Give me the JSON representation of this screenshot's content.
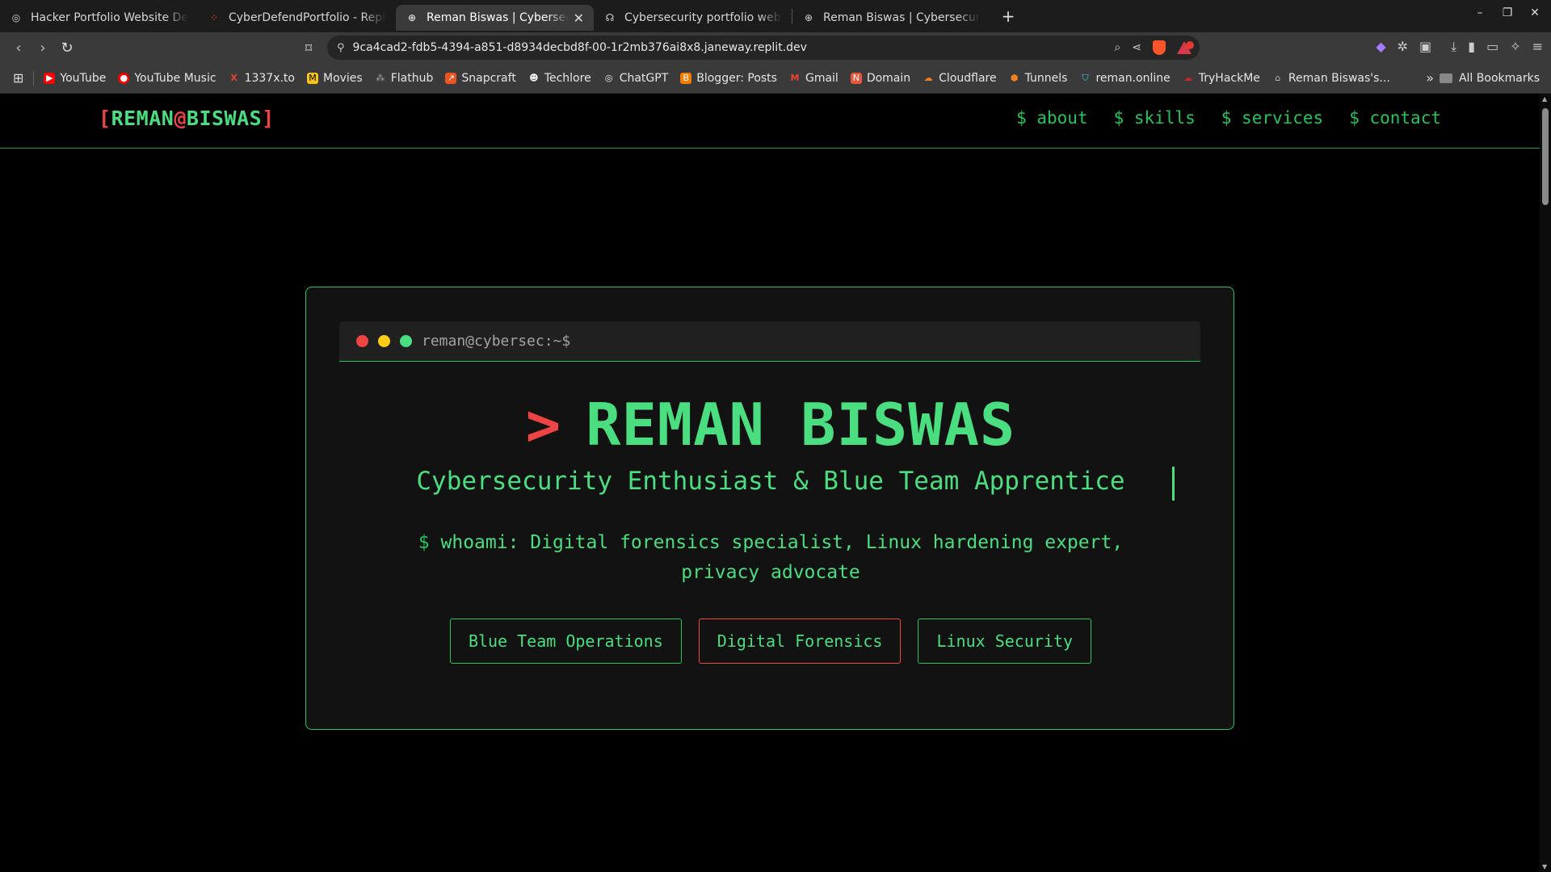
{
  "browser": {
    "tabs": [
      {
        "title": "Hacker Portfolio Website Design",
        "icon": "chatgpt-icon",
        "active": false
      },
      {
        "title": "CyberDefendPortfolio - Replit",
        "icon": "replit-icon",
        "active": false
      },
      {
        "title": "Reman Biswas | Cybersecur",
        "icon": "globe-icon",
        "active": true,
        "close": "✕"
      },
      {
        "title": "Cybersecurity portfolio website",
        "icon": "copilot-icon",
        "active": false
      },
      {
        "title": "Reman Biswas | Cybersecurity P",
        "icon": "globe-icon",
        "active": false
      }
    ],
    "new_tab": "+",
    "url": "9ca4cad2-fdb5-4394-a851-d8934decbd8f-00-1r2mb376ai8x8.janeway.replit.dev",
    "bookmarks": [
      {
        "label": "YouTube",
        "icon": "youtube-icon",
        "color": "#ff0000"
      },
      {
        "label": "YouTube Music",
        "icon": "youtube-music-icon",
        "color": "#ff0000"
      },
      {
        "label": "1337x.to",
        "icon": "1337x-icon",
        "color": "#e0482f"
      },
      {
        "label": "Movies",
        "icon": "movies-icon",
        "color": "#f5c518"
      },
      {
        "label": "Flathub",
        "icon": "flathub-icon",
        "color": "#9a9a9a"
      },
      {
        "label": "Snapcraft",
        "icon": "snapcraft-icon",
        "color": "#e95420"
      },
      {
        "label": "Techlore",
        "icon": "techlore-icon",
        "color": "#dddddd"
      },
      {
        "label": "ChatGPT",
        "icon": "chatgpt-icon",
        "color": "#dddddd"
      },
      {
        "label": "Blogger: Posts",
        "icon": "blogger-icon",
        "color": "#f57d00"
      },
      {
        "label": "Gmail",
        "icon": "gmail-icon",
        "color": "#ea4335"
      },
      {
        "label": "Domain",
        "icon": "domain-icon",
        "color": "#e8573c"
      },
      {
        "label": "Cloudflare",
        "icon": "cloudflare-icon",
        "color": "#f38020"
      },
      {
        "label": "Tunnels",
        "icon": "tunnels-icon",
        "color": "#f38020"
      },
      {
        "label": "reman.online",
        "icon": "shield-icon",
        "color": "#4dd0e1"
      },
      {
        "label": "TryHackMe",
        "icon": "tryhackme-icon",
        "color": "#c62828"
      },
      {
        "label": "Reman Biswas's...",
        "icon": "home-icon",
        "color": "#bbbbbb"
      }
    ],
    "more_bookmarks": "»",
    "all_bookmarks": "All Bookmarks"
  },
  "site": {
    "logo": {
      "open": "[",
      "first": "REMAN",
      "at": "@",
      "last": "BISWAS",
      "close": "]"
    },
    "nav": [
      "$ about",
      "$ skills",
      "$ services",
      "$ contact"
    ],
    "terminal": {
      "prompt": "reman@cybersec:~$",
      "name_prefix": ">",
      "name": "REMAN BISWAS",
      "tagline": "Cybersecurity Enthusiast & Blue Team Apprentice",
      "whoami_prefix": "$",
      "whoami": "whoami: Digital forensics specialist, Linux hardening expert, privacy advocate",
      "chips": [
        "Blue Team Operations",
        "Digital Forensics",
        "Linux Security"
      ]
    },
    "colors": {
      "accent": "#4ade80",
      "alert": "#ef4444",
      "background": "#000000"
    }
  }
}
